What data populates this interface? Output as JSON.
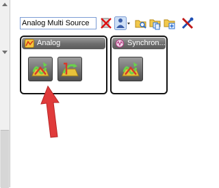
{
  "toolbar": {
    "search_value": "Analog Multi Source",
    "icons": [
      "remove-icon",
      "person-dropdown-icon",
      "folder-search-icon",
      "folder-copy-icon",
      "folder-add-icon",
      "tools-icon"
    ]
  },
  "groups": [
    {
      "title": "Analog",
      "tiles": [
        "analog-multi-source-block-icon",
        "analog-source-block-icon"
      ]
    },
    {
      "title": "Synchron...",
      "tiles": [
        "synchronous-multi-source-block-icon"
      ]
    }
  ],
  "colors": {
    "header_gradient_top": "#9a9a9a",
    "header_gradient_bottom": "#5a5a5a",
    "arrow_red": "#e03b3b",
    "tile_dark": "#4f4f4f"
  }
}
